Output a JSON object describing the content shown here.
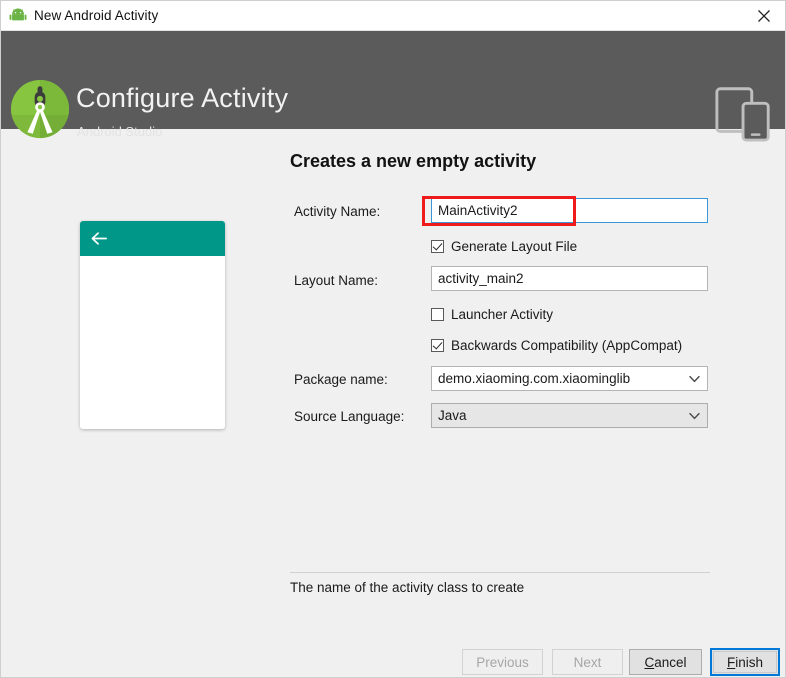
{
  "window": {
    "title": "New Android Activity",
    "title_icon": "android-robot-icon",
    "close_icon": "close-icon"
  },
  "header": {
    "title": "Configure Activity",
    "subtitle": "Android Studio",
    "logo_icon": "android-studio-logo-icon",
    "devices_icon": "tablet-and-phone-icon",
    "background_color": "#5b5b5b"
  },
  "main": {
    "heading": "Creates a new empty activity",
    "preview": {
      "appbar_color": "#009688",
      "back_icon": "arrow-back-icon"
    },
    "fields": {
      "activity_name": {
        "label": "Activity Name:",
        "value": "MainActivity2",
        "focused": true
      },
      "generate_layout_file": {
        "label": "Generate Layout File",
        "checked": true
      },
      "layout_name": {
        "label": "Layout Name:",
        "value": "activity_main2"
      },
      "launcher_activity": {
        "label": "Launcher Activity",
        "checked": false
      },
      "backwards_compatibility": {
        "label": "Backwards Compatibility (AppCompat)",
        "checked": true
      },
      "package_name": {
        "label": "Package name:",
        "value": "demo.xiaoming.com.xiaominglib",
        "arrow_icon": "chevron-down-icon"
      },
      "source_language": {
        "label": "Source Language:",
        "value": "Java",
        "arrow_icon": "chevron-down-icon"
      }
    },
    "annotation": {
      "color": "#ef1b1b",
      "target": "activity-name-input"
    }
  },
  "footer": {
    "hint": "The name of the activity class to create",
    "buttons": {
      "previous": {
        "label": "Previous",
        "enabled": false
      },
      "next": {
        "label": "Next",
        "enabled": false
      },
      "cancel": {
        "label": "Cancel",
        "mnemonic": "C",
        "enabled": true
      },
      "finish": {
        "label": "Finish",
        "mnemonic": "F",
        "enabled": true,
        "focused": true
      }
    },
    "focus_color": "#0078d7"
  }
}
